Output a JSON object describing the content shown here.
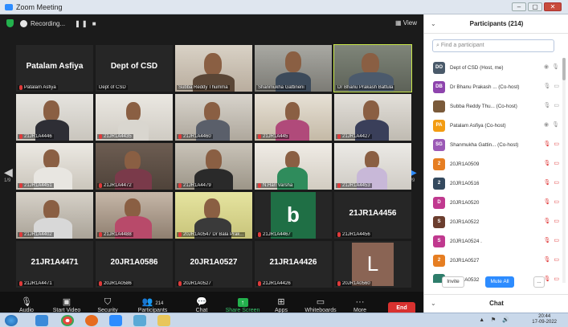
{
  "window": {
    "title": "Zoom Meeting"
  },
  "topbar": {
    "recording_label": "Recording...",
    "view_label": "View"
  },
  "pager": {
    "left": "1/9",
    "right": "1/9"
  },
  "tiles": [
    {
      "big": "Patalam Asfiya",
      "label": "Patalam Asfiya"
    },
    {
      "big": "Dept of CSD",
      "label": "Dept of CSD"
    },
    {
      "big": "",
      "label": "Subba Reddy Thumma"
    },
    {
      "big": "",
      "label": "Shanmukha Gattineni"
    },
    {
      "big": "",
      "label": "Dr Bhanu Prakash Battula"
    },
    {
      "big": "",
      "label": "21JR1A4446"
    },
    {
      "big": "",
      "label": "21JR1A4435"
    },
    {
      "big": "",
      "label": "21JR1A4460"
    },
    {
      "big": "",
      "label": "21JR1A445"
    },
    {
      "big": "",
      "label": "21JR1A4427"
    },
    {
      "big": "",
      "label": "21JR1A4451"
    },
    {
      "big": "",
      "label": "21JR1A4472"
    },
    {
      "big": "",
      "label": "21JR1A4479"
    },
    {
      "big": "",
      "label": "N.Hari Varsha"
    },
    {
      "big": "",
      "label": "21JR1A4453"
    },
    {
      "big": "",
      "label": "21JR1A4402"
    },
    {
      "big": "",
      "label": "21JR1A4488"
    },
    {
      "big": "",
      "label": "20JR1A0547 Dr Bala Prak..."
    },
    {
      "big": "b",
      "label": "21JR1A4467"
    },
    {
      "big": "21JR1A4456",
      "label": "21JR1A4456"
    },
    {
      "big": "21JR1A4471",
      "label": "21JR1A4471"
    },
    {
      "big": "20JR1A0586",
      "label": "20JR1A0586"
    },
    {
      "big": "20JR1A0527",
      "label": "20JR1A0527"
    },
    {
      "big": "21JR1A4426",
      "label": "21JR1A4426"
    },
    {
      "big": "L",
      "label": "20JR1A0560"
    }
  ],
  "toolbar": {
    "audio": "Audio",
    "start_video": "Start Video",
    "security": "Security",
    "participants": "Participants",
    "participants_count": "214",
    "chat": "Chat",
    "share_screen": "Share Screen",
    "apps": "Apps",
    "whiteboards": "Whiteboards",
    "more": "More",
    "end": "End"
  },
  "panel": {
    "title": "Participants (214)",
    "search_placeholder": "Find a participant",
    "participants": [
      {
        "initials": "DO",
        "color": "#4a5a6a",
        "name": "Dept of CSD (Host, me)"
      },
      {
        "initials": "DB",
        "color": "#8e44ad",
        "name": "Dr Bhanu Prakash ... (Co-host)"
      },
      {
        "initials": "",
        "color": "#7a5a3a",
        "name": "Subba Reddy Thu... (Co-host)"
      },
      {
        "initials": "PA",
        "color": "#f39c12",
        "name": "Patalam Asfiya (Co-host)"
      },
      {
        "initials": "SG",
        "color": "#9b59b6",
        "name": "Shanmukha Gattin... (Co-host)"
      },
      {
        "initials": "2",
        "color": "#e67e22",
        "name": "20JR1A0509"
      },
      {
        "initials": "2",
        "color": "#34495e",
        "name": "20JR1A0516"
      },
      {
        "initials": "D",
        "color": "#c0398f",
        "name": "20JR1A0520"
      },
      {
        "initials": "S",
        "color": "#6b3e2e",
        "name": "20JR1A0522"
      },
      {
        "initials": "S",
        "color": "#c0398f",
        "name": "20JR1A0524 ."
      },
      {
        "initials": "2",
        "color": "#e67e22",
        "name": "20JR1A0527"
      },
      {
        "initials": "",
        "color": "#2e7d6b",
        "name": "20JR1A0532"
      }
    ],
    "invite": "Invite",
    "mute_all": "Mute All",
    "more": "...",
    "chat_title": "Chat"
  },
  "taskbar": {
    "time": "20:44",
    "date": "17-09-2022"
  }
}
